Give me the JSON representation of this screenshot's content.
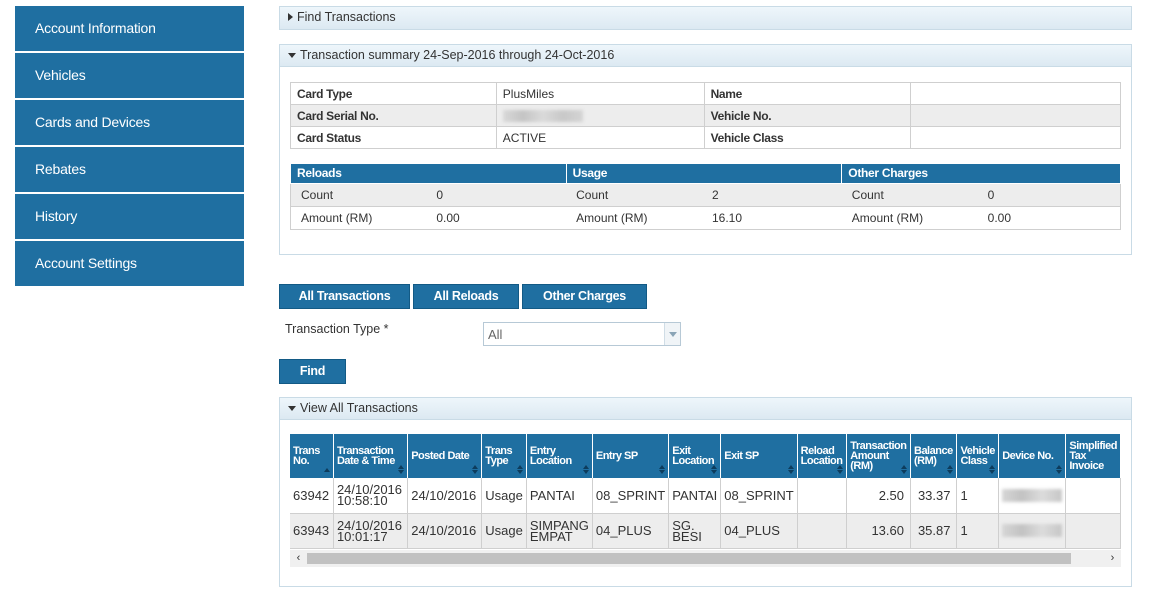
{
  "sidebar": {
    "items": [
      {
        "label": "Account Information"
      },
      {
        "label": "Vehicles"
      },
      {
        "label": "Cards and Devices"
      },
      {
        "label": "Rebates"
      },
      {
        "label": "History"
      },
      {
        "label": "Account Settings"
      }
    ]
  },
  "find_panel": {
    "title": "Find Transactions"
  },
  "summary_panel": {
    "title": "Transaction summary 24-Sep-2016 through 24-Oct-2016",
    "card": {
      "card_type_label": "Card Type",
      "card_type_value": "PlusMiles",
      "name_label": "Name",
      "name_value": "",
      "serial_label": "Card Serial No.",
      "vehicle_no_label": "Vehicle No.",
      "vehicle_no_value": "",
      "status_label": "Card Status",
      "status_value": "ACTIVE",
      "vehicle_class_label": "Vehicle Class",
      "vehicle_class_value": ""
    },
    "stats": {
      "reloads_header": "Reloads",
      "usage_header": "Usage",
      "other_header": "Other Charges",
      "count_label": "Count",
      "amount_label": "Amount (RM)",
      "reloads_count": "0",
      "reloads_amount": "0.00",
      "usage_count": "2",
      "usage_amount": "16.10",
      "other_count": "0",
      "other_amount": "0.00"
    }
  },
  "filters": {
    "all_transactions": "All Transactions",
    "all_reloads": "All Reloads",
    "other_charges": "Other Charges",
    "transaction_type_label": "Transaction Type *",
    "transaction_type_value": "All",
    "find_button": "Find"
  },
  "view_panel": {
    "title": "View All Transactions",
    "columns": {
      "trans_no": "Trans No.",
      "datetime": "Transaction Date & Time",
      "posted_date": "Posted Date",
      "trans_type": "Trans Type",
      "entry_location": "Entry Location",
      "entry_sp": "Entry SP",
      "exit_location": "Exit Location",
      "exit_sp": "Exit SP",
      "reload_location": "Reload Location",
      "amount": "Transaction Amount (RM)",
      "balance": "Balance (RM)",
      "vehicle_class": "Vehicle Class",
      "device_no": "Device No.",
      "simplified_tax": "Simplified Tax Invoice"
    },
    "rows": [
      {
        "trans_no": "63942",
        "datetime": "24/10/2016 10:58:10",
        "posted_date": "24/10/2016",
        "trans_type": "Usage",
        "entry_location": "PANTAI",
        "entry_sp": "08_SPRINT",
        "exit_location": "PANTAI",
        "exit_sp": "08_SPRINT",
        "reload_location": "",
        "amount": "2.50",
        "balance": "33.37",
        "vehicle_class": "1"
      },
      {
        "trans_no": "63943",
        "datetime": "24/10/2016 10:01:17",
        "posted_date": "24/10/2016",
        "trans_type": "Usage",
        "entry_location": "SIMPANG EMPAT",
        "entry_sp": "04_PLUS",
        "exit_location": "SG. BESI",
        "exit_sp": "04_PLUS",
        "reload_location": "",
        "amount": "13.60",
        "balance": "35.87",
        "vehicle_class": "1"
      }
    ]
  },
  "colors": {
    "primary": "#1f6fa1",
    "panel_header": "#dce9f2",
    "row_alt": "#ededed"
  },
  "icons": {
    "scroll_left": "‹",
    "scroll_right": "›"
  }
}
